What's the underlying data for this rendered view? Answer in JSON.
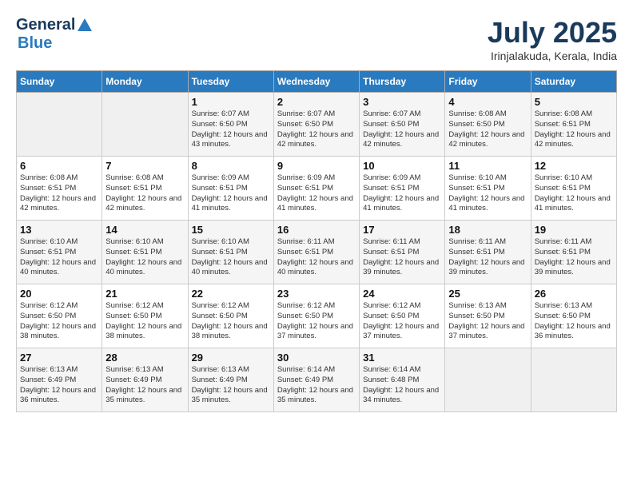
{
  "header": {
    "logo_line1": "General",
    "logo_line2": "Blue",
    "month": "July 2025",
    "location": "Irinjalakuda, Kerala, India"
  },
  "days_of_week": [
    "Sunday",
    "Monday",
    "Tuesday",
    "Wednesday",
    "Thursday",
    "Friday",
    "Saturday"
  ],
  "weeks": [
    [
      {
        "day": "",
        "info": ""
      },
      {
        "day": "",
        "info": ""
      },
      {
        "day": "1",
        "info": "Sunrise: 6:07 AM\nSunset: 6:50 PM\nDaylight: 12 hours\nand 43 minutes."
      },
      {
        "day": "2",
        "info": "Sunrise: 6:07 AM\nSunset: 6:50 PM\nDaylight: 12 hours\nand 42 minutes."
      },
      {
        "day": "3",
        "info": "Sunrise: 6:07 AM\nSunset: 6:50 PM\nDaylight: 12 hours\nand 42 minutes."
      },
      {
        "day": "4",
        "info": "Sunrise: 6:08 AM\nSunset: 6:50 PM\nDaylight: 12 hours\nand 42 minutes."
      },
      {
        "day": "5",
        "info": "Sunrise: 6:08 AM\nSunset: 6:51 PM\nDaylight: 12 hours\nand 42 minutes."
      }
    ],
    [
      {
        "day": "6",
        "info": "Sunrise: 6:08 AM\nSunset: 6:51 PM\nDaylight: 12 hours\nand 42 minutes."
      },
      {
        "day": "7",
        "info": "Sunrise: 6:08 AM\nSunset: 6:51 PM\nDaylight: 12 hours\nand 42 minutes."
      },
      {
        "day": "8",
        "info": "Sunrise: 6:09 AM\nSunset: 6:51 PM\nDaylight: 12 hours\nand 41 minutes."
      },
      {
        "day": "9",
        "info": "Sunrise: 6:09 AM\nSunset: 6:51 PM\nDaylight: 12 hours\nand 41 minutes."
      },
      {
        "day": "10",
        "info": "Sunrise: 6:09 AM\nSunset: 6:51 PM\nDaylight: 12 hours\nand 41 minutes."
      },
      {
        "day": "11",
        "info": "Sunrise: 6:10 AM\nSunset: 6:51 PM\nDaylight: 12 hours\nand 41 minutes."
      },
      {
        "day": "12",
        "info": "Sunrise: 6:10 AM\nSunset: 6:51 PM\nDaylight: 12 hours\nand 41 minutes."
      }
    ],
    [
      {
        "day": "13",
        "info": "Sunrise: 6:10 AM\nSunset: 6:51 PM\nDaylight: 12 hours\nand 40 minutes."
      },
      {
        "day": "14",
        "info": "Sunrise: 6:10 AM\nSunset: 6:51 PM\nDaylight: 12 hours\nand 40 minutes."
      },
      {
        "day": "15",
        "info": "Sunrise: 6:10 AM\nSunset: 6:51 PM\nDaylight: 12 hours\nand 40 minutes."
      },
      {
        "day": "16",
        "info": "Sunrise: 6:11 AM\nSunset: 6:51 PM\nDaylight: 12 hours\nand 40 minutes."
      },
      {
        "day": "17",
        "info": "Sunrise: 6:11 AM\nSunset: 6:51 PM\nDaylight: 12 hours\nand 39 minutes."
      },
      {
        "day": "18",
        "info": "Sunrise: 6:11 AM\nSunset: 6:51 PM\nDaylight: 12 hours\nand 39 minutes."
      },
      {
        "day": "19",
        "info": "Sunrise: 6:11 AM\nSunset: 6:51 PM\nDaylight: 12 hours\nand 39 minutes."
      }
    ],
    [
      {
        "day": "20",
        "info": "Sunrise: 6:12 AM\nSunset: 6:50 PM\nDaylight: 12 hours\nand 38 minutes."
      },
      {
        "day": "21",
        "info": "Sunrise: 6:12 AM\nSunset: 6:50 PM\nDaylight: 12 hours\nand 38 minutes."
      },
      {
        "day": "22",
        "info": "Sunrise: 6:12 AM\nSunset: 6:50 PM\nDaylight: 12 hours\nand 38 minutes."
      },
      {
        "day": "23",
        "info": "Sunrise: 6:12 AM\nSunset: 6:50 PM\nDaylight: 12 hours\nand 37 minutes."
      },
      {
        "day": "24",
        "info": "Sunrise: 6:12 AM\nSunset: 6:50 PM\nDaylight: 12 hours\nand 37 minutes."
      },
      {
        "day": "25",
        "info": "Sunrise: 6:13 AM\nSunset: 6:50 PM\nDaylight: 12 hours\nand 37 minutes."
      },
      {
        "day": "26",
        "info": "Sunrise: 6:13 AM\nSunset: 6:50 PM\nDaylight: 12 hours\nand 36 minutes."
      }
    ],
    [
      {
        "day": "27",
        "info": "Sunrise: 6:13 AM\nSunset: 6:49 PM\nDaylight: 12 hours\nand 36 minutes."
      },
      {
        "day": "28",
        "info": "Sunrise: 6:13 AM\nSunset: 6:49 PM\nDaylight: 12 hours\nand 35 minutes."
      },
      {
        "day": "29",
        "info": "Sunrise: 6:13 AM\nSunset: 6:49 PM\nDaylight: 12 hours\nand 35 minutes."
      },
      {
        "day": "30",
        "info": "Sunrise: 6:14 AM\nSunset: 6:49 PM\nDaylight: 12 hours\nand 35 minutes."
      },
      {
        "day": "31",
        "info": "Sunrise: 6:14 AM\nSunset: 6:48 PM\nDaylight: 12 hours\nand 34 minutes."
      },
      {
        "day": "",
        "info": ""
      },
      {
        "day": "",
        "info": ""
      }
    ]
  ]
}
